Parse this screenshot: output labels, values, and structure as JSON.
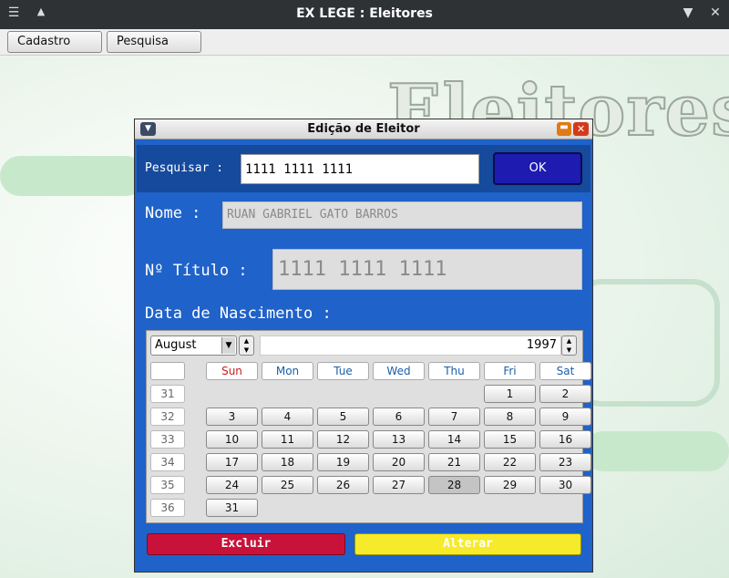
{
  "window": {
    "title": "EX LEGE : Eleitores"
  },
  "menu": {
    "cadastro": "Cadastro [+]",
    "pesquisa": "Pesquisa [+]"
  },
  "background": {
    "title": "Eleitores"
  },
  "dialog": {
    "title": "Edição de Eleitor",
    "search_label": "Pesquisar :",
    "search_value": "1111 1111 1111",
    "ok_label": "OK",
    "nome_label": "Nome :",
    "nome_value": "RUAN GABRIEL GATO BARROS",
    "titulo_label": "Nº Título :",
    "titulo_value": "1111 1111 1111",
    "nascimento_label": "Data de Nascimento :",
    "excluir_label": "Excluir",
    "alterar_label": "Alterar"
  },
  "calendar": {
    "month": "August",
    "year": "1997",
    "selected_day": "28",
    "weekdays": [
      "Sun",
      "Mon",
      "Tue",
      "Wed",
      "Thu",
      "Fri",
      "Sat"
    ],
    "weeks": [
      {
        "week": "31",
        "days": [
          "",
          "",
          "",
          "",
          "",
          "1",
          "2"
        ]
      },
      {
        "week": "32",
        "days": [
          "3",
          "4",
          "5",
          "6",
          "7",
          "8",
          "9"
        ]
      },
      {
        "week": "33",
        "days": [
          "10",
          "11",
          "12",
          "13",
          "14",
          "15",
          "16"
        ]
      },
      {
        "week": "34",
        "days": [
          "17",
          "18",
          "19",
          "20",
          "21",
          "22",
          "23"
        ]
      },
      {
        "week": "35",
        "days": [
          "24",
          "25",
          "26",
          "27",
          "28",
          "29",
          "30"
        ]
      },
      {
        "week": "36",
        "days": [
          "31",
          "",
          "",
          "",
          "",
          "",
          ""
        ]
      }
    ]
  },
  "colors": {
    "dialog_bg": "#1f62c9",
    "ok_button": "#1e1bb0",
    "excluir": "#c8123a",
    "alterar": "#f6ea2a"
  }
}
